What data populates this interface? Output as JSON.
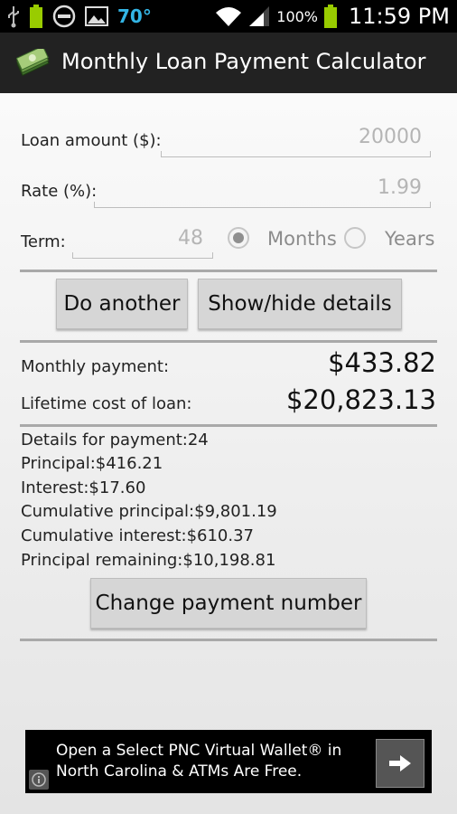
{
  "status_bar": {
    "temperature": "70°",
    "battery_percent": "100%",
    "time": "11:59 PM"
  },
  "app": {
    "title": "Monthly Loan Payment Calculator"
  },
  "form": {
    "loan_amount_label": "Loan amount ($):",
    "loan_amount_value": "20000",
    "rate_label": "Rate (%):",
    "rate_value": "1.99",
    "term_label": "Term:",
    "term_value": "48",
    "term_unit_options": [
      "Months",
      "Years"
    ],
    "term_unit_selected": "Months"
  },
  "buttons": {
    "do_another": "Do another",
    "show_hide_details": "Show/hide details",
    "change_payment_number": "Change payment number"
  },
  "results": {
    "monthly_payment_label": "Monthly payment:",
    "monthly_payment_value": "$433.82",
    "lifetime_cost_label": "Lifetime cost of loan:",
    "lifetime_cost_value": "$20,823.13"
  },
  "details": [
    "Details for payment:24",
    "Principal:$416.21",
    "Interest:$17.60",
    "Cumulative principal:$9,801.19",
    "Cumulative interest:$610.37",
    "Principal remaining:$10,198.81"
  ],
  "ad": {
    "text": "Open a Select PNC Virtual Wallet® in North Carolina & ATMs Are Free."
  },
  "colors": {
    "status_accent": "#33b5e5",
    "battery_green": "#99cc00",
    "action_bar": "#222222",
    "button_bg": "#d6d6d6"
  }
}
